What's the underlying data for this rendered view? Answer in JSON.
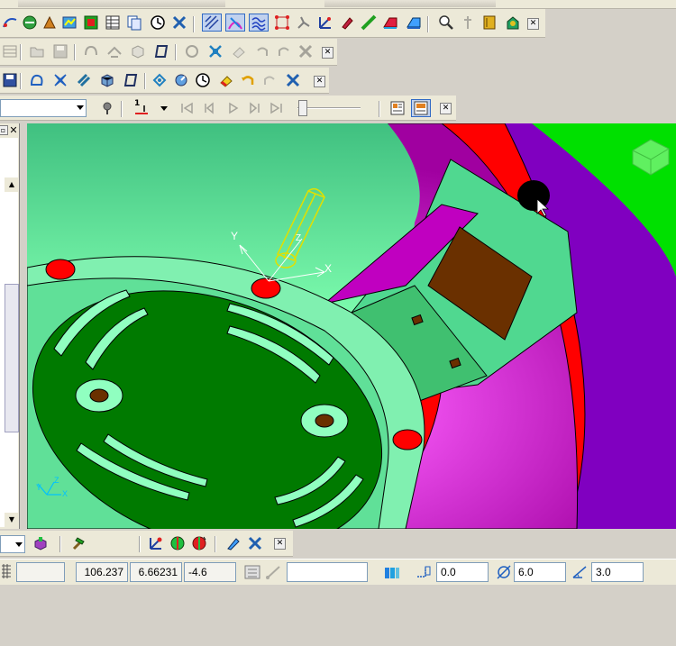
{
  "toolbar_row1": {
    "icons": [
      "curve-icon",
      "surface-icon",
      "solid-icon",
      "analysis-icon",
      "table-icon",
      "copy-icon",
      "clock-icon",
      "tool-x-icon",
      "hatch-icon",
      "gradient-icon",
      "wave-icon",
      "points-icon",
      "tweak-icon",
      "axis-icon",
      "paint-icon",
      "line-icon",
      "shade-icon",
      "shade-alt-icon",
      "search-icon",
      "probe-icon",
      "book-icon",
      "sim-icon"
    ]
  },
  "toolbar_row2": {
    "icons": [
      "wire-icon",
      "open-icon",
      "save-icon",
      "link-icon",
      "cube-icon",
      "frame-icon",
      "move-icon",
      "cross-icon",
      "eraser-icon",
      "undo-icon",
      "redo-icon",
      "delete-icon"
    ]
  },
  "toolbar_row3": {
    "icons": [
      "save-icon",
      "curve-icon",
      "star-icon",
      "layers-icon",
      "box-icon",
      "frame-icon",
      "swap-icon",
      "rotate-icon",
      "clock-icon",
      "eraser-icon",
      "undo-icon",
      "redo-icon",
      "tool-x-icon"
    ]
  },
  "playback_bar": {
    "step_value": "1",
    "controls": [
      "skip-start-icon",
      "step-back-icon",
      "play-icon",
      "step-forward-icon",
      "skip-end-icon"
    ]
  },
  "viewport": {
    "bg_color": "#00e000",
    "axis_labels": {
      "x": "X",
      "y": "Y",
      "z": "Z"
    },
    "triad_labels": {
      "x": "X",
      "y": "Y",
      "z": "Z"
    }
  },
  "bottom_toolbar": {
    "icons": [
      "material-icon",
      "hammer-icon",
      "axis-red-icon",
      "green-split-icon",
      "red-split-icon",
      "pen-icon",
      "tool-x-icon"
    ]
  },
  "status_bar": {
    "coord_x": "106.237",
    "coord_y": "6.66231",
    "coord_z": "-4.6",
    "field_a": "0.0",
    "field_b": "6.0",
    "field_c": "3.0"
  },
  "colors": {
    "accent_red": "#ff0000",
    "accent_magenta": "#c000c0",
    "model_green": "#7fe8a8",
    "dark_green": "#007a00",
    "brown": "#6a3000"
  }
}
